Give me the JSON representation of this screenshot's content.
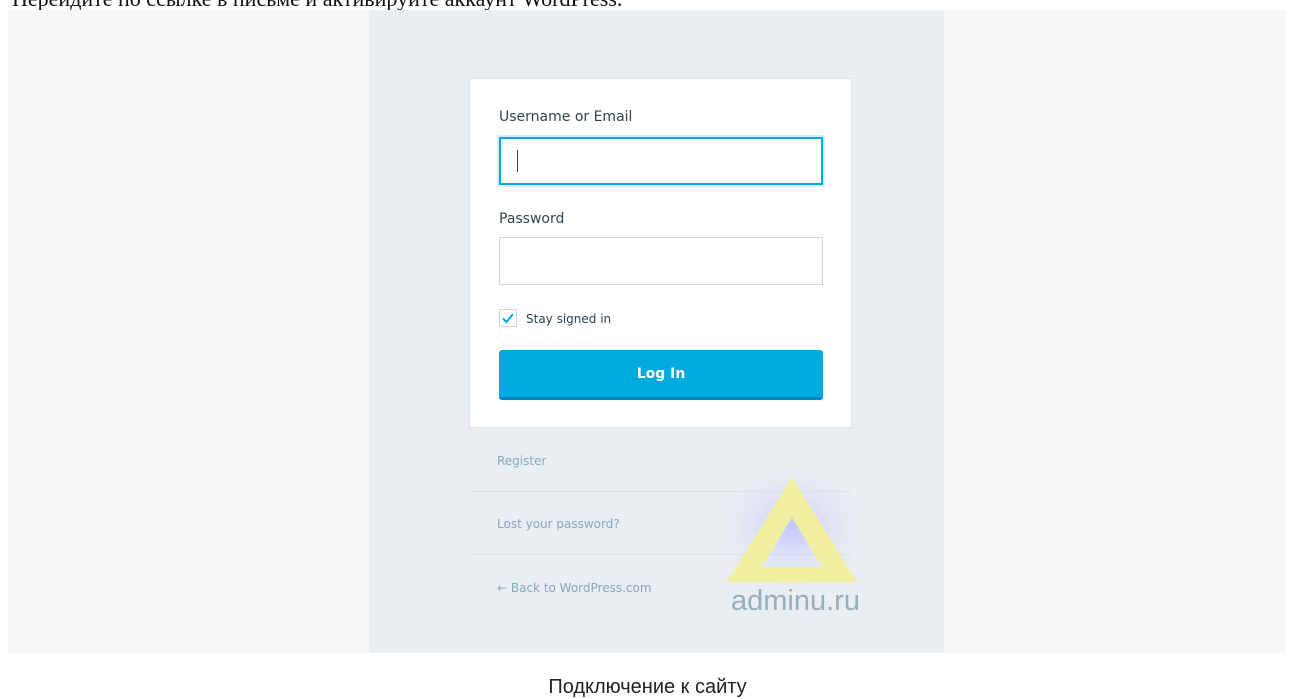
{
  "page": {
    "intro_text": "Перейдите по ссылке в письме и активируйте аккаунт WordPress.",
    "caption": "Подключение к сайту"
  },
  "login_form": {
    "username_label": "Username or Email",
    "username_value": "",
    "password_label": "Password",
    "password_value": "",
    "stay_signed_in_label": "Stay signed in",
    "stay_signed_in_checked": true,
    "login_button": "Log In"
  },
  "links": {
    "register": "Register",
    "lost_password": "Lost your password?",
    "back": "← Back to WordPress.com"
  },
  "watermark": {
    "letter": "A",
    "text": "adminu.ru"
  },
  "colors": {
    "accent": "#00aadc",
    "accent_dark": "#0087be",
    "text": "#2e4453",
    "muted_link": "#87a6bc",
    "screen_bg": "#e9eef2",
    "watermark_yellow": "#f2f0a0"
  }
}
